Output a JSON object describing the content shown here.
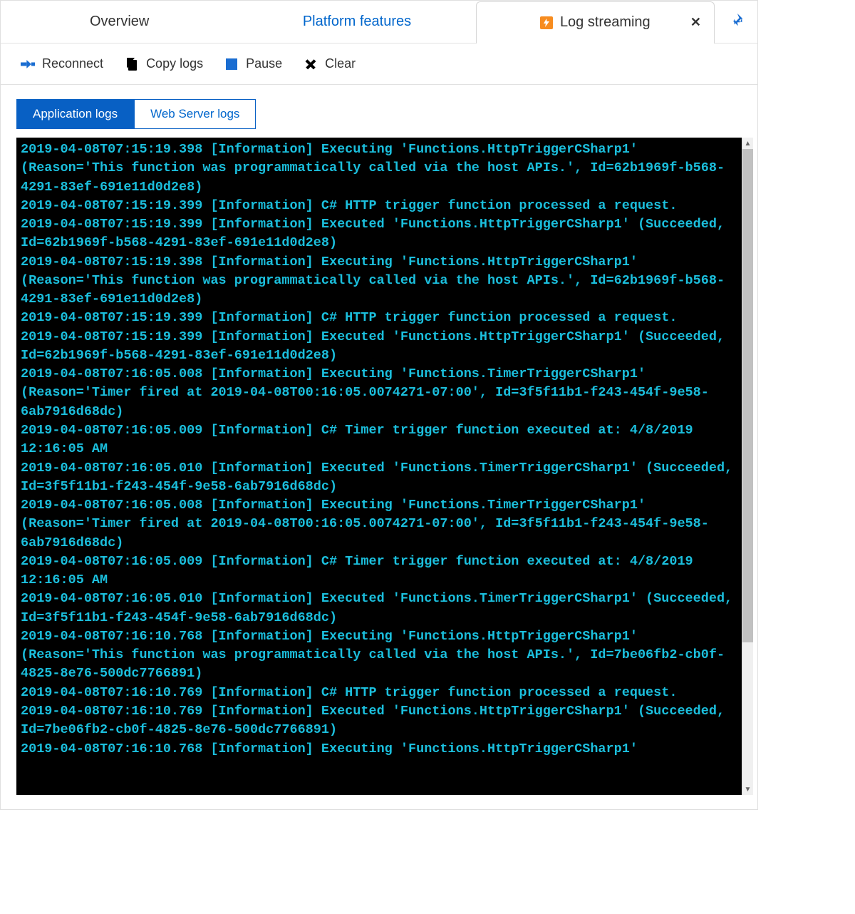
{
  "tabs": {
    "overview": "Overview",
    "platform": "Platform features",
    "log": "Log streaming"
  },
  "toolbar": {
    "reconnect": "Reconnect",
    "copy": "Copy logs",
    "pause": "Pause",
    "clear": "Clear"
  },
  "subtabs": {
    "app": "Application logs",
    "web": "Web Server logs"
  },
  "log_lines": [
    "2019-04-08T07:15:19.398 [Information] Executing 'Functions.HttpTriggerCSharp1' (Reason='This function was programmatically called via the host APIs.', Id=62b1969f-b568-4291-83ef-691e11d0d2e8)",
    "2019-04-08T07:15:19.399 [Information] C# HTTP trigger function processed a request.",
    "2019-04-08T07:15:19.399 [Information] Executed 'Functions.HttpTriggerCSharp1' (Succeeded, Id=62b1969f-b568-4291-83ef-691e11d0d2e8)",
    "2019-04-08T07:15:19.398 [Information] Executing 'Functions.HttpTriggerCSharp1' (Reason='This function was programmatically called via the host APIs.', Id=62b1969f-b568-4291-83ef-691e11d0d2e8)",
    "2019-04-08T07:15:19.399 [Information] C# HTTP trigger function processed a request.",
    "2019-04-08T07:15:19.399 [Information] Executed 'Functions.HttpTriggerCSharp1' (Succeeded, Id=62b1969f-b568-4291-83ef-691e11d0d2e8)",
    "2019-04-08T07:16:05.008 [Information] Executing 'Functions.TimerTriggerCSharp1' (Reason='Timer fired at 2019-04-08T00:16:05.0074271-07:00', Id=3f5f11b1-f243-454f-9e58-6ab7916d68dc)",
    "2019-04-08T07:16:05.009 [Information] C# Timer trigger function executed at: 4/8/2019 12:16:05 AM",
    "2019-04-08T07:16:05.010 [Information] Executed 'Functions.TimerTriggerCSharp1' (Succeeded, Id=3f5f11b1-f243-454f-9e58-6ab7916d68dc)",
    "2019-04-08T07:16:05.008 [Information] Executing 'Functions.TimerTriggerCSharp1' (Reason='Timer fired at 2019-04-08T00:16:05.0074271-07:00', Id=3f5f11b1-f243-454f-9e58-6ab7916d68dc)",
    "2019-04-08T07:16:05.009 [Information] C# Timer trigger function executed at: 4/8/2019 12:16:05 AM",
    "2019-04-08T07:16:05.010 [Information] Executed 'Functions.TimerTriggerCSharp1' (Succeeded, Id=3f5f11b1-f243-454f-9e58-6ab7916d68dc)",
    "2019-04-08T07:16:10.768 [Information] Executing 'Functions.HttpTriggerCSharp1' (Reason='This function was programmatically called via the host APIs.', Id=7be06fb2-cb0f-4825-8e76-500dc7766891)",
    "2019-04-08T07:16:10.769 [Information] C# HTTP trigger function processed a request.",
    "2019-04-08T07:16:10.769 [Information] Executed 'Functions.HttpTriggerCSharp1' (Succeeded, Id=7be06fb2-cb0f-4825-8e76-500dc7766891)",
    "2019-04-08T07:16:10.768 [Information] Executing 'Functions.HttpTriggerCSharp1'"
  ]
}
